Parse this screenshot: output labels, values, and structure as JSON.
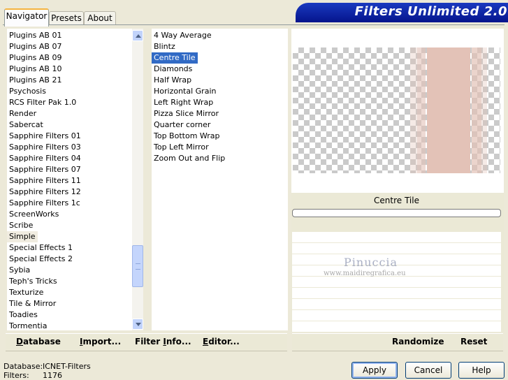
{
  "app": {
    "title": "Filters Unlimited 2.0"
  },
  "tabs": [
    {
      "label": "Navigator",
      "active": true
    },
    {
      "label": "Presets",
      "active": false
    },
    {
      "label": "About",
      "active": false
    }
  ],
  "categories": {
    "items": [
      "Plugins AB 01",
      "Plugins AB 07",
      "Plugins AB 09",
      "Plugins AB 10",
      "Plugins AB 21",
      "Psychosis",
      "RCS Filter Pak 1.0",
      "Render",
      "Sabercat",
      "Sapphire Filters 01",
      "Sapphire Filters 03",
      "Sapphire Filters 04",
      "Sapphire Filters 07",
      "Sapphire Filters 11",
      "Sapphire Filters 12",
      "Sapphire Filters 1c",
      "ScreenWorks",
      "Scribe",
      "Simple",
      "Special Effects 1",
      "Special Effects 2",
      "Sybia",
      "Teph's Tricks",
      "Texturize",
      "Tile & Mirror",
      "Toadies",
      "Tormentia"
    ],
    "selected": "Simple"
  },
  "filters": {
    "items": [
      "4 Way Average",
      "Blintz",
      "Centre Tile",
      "Diamonds",
      "Half Wrap",
      "Horizontal Grain",
      "Left Right Wrap",
      "Pizza Slice Mirror",
      "Quarter corner",
      "Top Bottom Wrap",
      "Top Left Mirror",
      "Zoom Out and Flip"
    ],
    "selected": "Centre Tile"
  },
  "preview": {
    "filter_name": "Centre Tile",
    "progress": 0,
    "tile_color": "#e3c2b7",
    "watermark_name": "Pinuccia",
    "watermark_url": "www.maidiregrafica.eu"
  },
  "left_buttons": {
    "database": {
      "prefix": "",
      "accel": "D",
      "rest": "atabase"
    },
    "import": {
      "prefix": "",
      "accel": "I",
      "rest": "mport..."
    },
    "filter_info": {
      "prefix": "Filter ",
      "accel": "I",
      "rest": "nfo..."
    },
    "editor": {
      "prefix": "",
      "accel": "E",
      "rest": "ditor..."
    }
  },
  "right_buttons": {
    "randomize": "Randomize",
    "reset": "Reset"
  },
  "status": {
    "database_label": "Database:",
    "database_value": "ICNET-Filters",
    "filters_label": "Filters:",
    "filters_value": "1176"
  },
  "dialog_buttons": {
    "apply": "Apply",
    "cancel": "Cancel",
    "help": "Help"
  },
  "colors": {
    "accent": "#316ac5",
    "banner": "#0a1e9c",
    "panel": "#ece9d8"
  }
}
